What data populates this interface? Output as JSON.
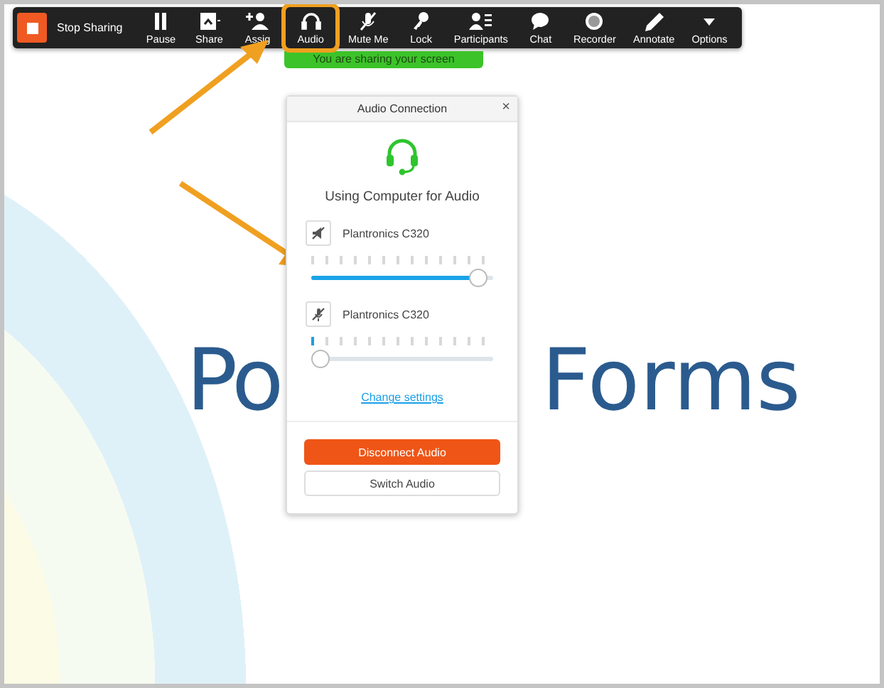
{
  "toolbar": {
    "stop_button": "Stop Sharing",
    "items": [
      {
        "kind": "pause",
        "label": "Pause",
        "highlighted": false
      },
      {
        "kind": "share",
        "label": "Share",
        "highlighted": false
      },
      {
        "kind": "assign",
        "label": "Assig",
        "highlighted": false
      },
      {
        "kind": "audio",
        "label": "Audio",
        "highlighted": true
      },
      {
        "kind": "mute",
        "label": "Mute Me",
        "highlighted": false
      },
      {
        "kind": "lock",
        "label": "Lock",
        "highlighted": false
      },
      {
        "kind": "participants",
        "label": "Participants",
        "highlighted": false
      },
      {
        "kind": "chat",
        "label": "Chat",
        "highlighted": false
      },
      {
        "kind": "recorder",
        "label": "Recorder",
        "highlighted": false
      },
      {
        "kind": "annotate",
        "label": "Annotate",
        "highlighted": false
      },
      {
        "kind": "options",
        "label": "Options",
        "highlighted": false
      }
    ]
  },
  "banner": "You are sharing your screen",
  "slide": {
    "title_left": "Po",
    "title_right": "Forms"
  },
  "dialog": {
    "title": "Audio Connection",
    "close": "×",
    "heading": "Using Computer for Audio",
    "devices": [
      {
        "kind": "speaker",
        "name": "Plantronics C320",
        "level": 0.95,
        "meter": {
          "level": 0
        }
      },
      {
        "kind": "microphone",
        "name": "Plantronics C320",
        "level": 0,
        "meter": {
          "level": 0.08
        }
      }
    ],
    "link": "Change settings",
    "primary_button": "Disconnect Audio",
    "secondary_button": "Switch Audio"
  }
}
